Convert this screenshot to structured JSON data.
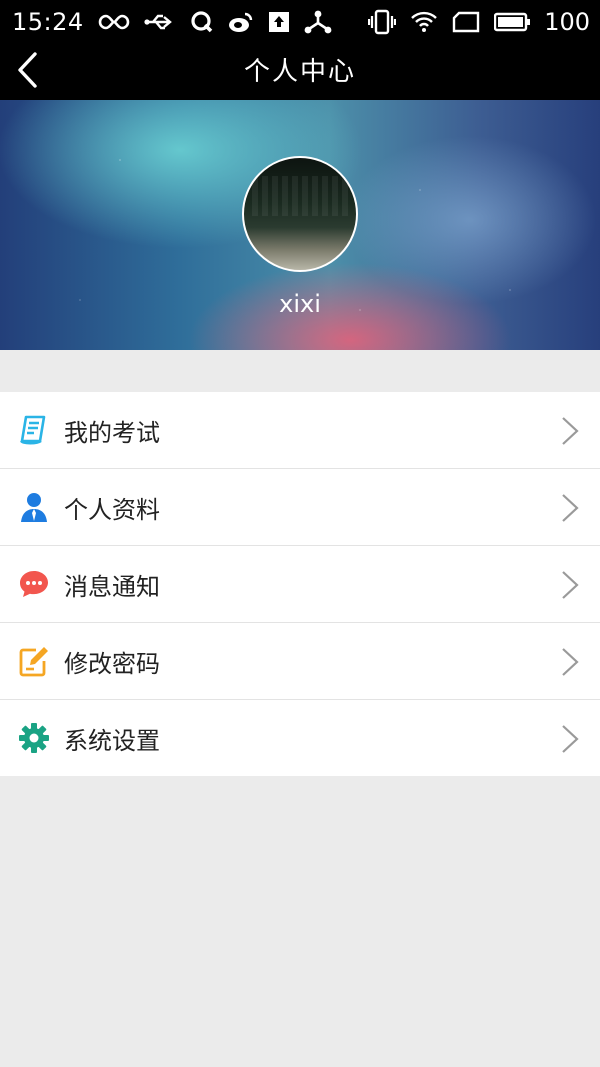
{
  "status_bar": {
    "time": "15:24",
    "battery_level": "100",
    "left_icons": [
      "infinity-icon",
      "usb-icon",
      "q-app-icon",
      "weibo-icon",
      "upload-icon",
      "share-icon"
    ],
    "right_icons": [
      "vibrate-icon",
      "wifi-icon",
      "sim-icon",
      "battery-icon"
    ]
  },
  "header": {
    "title": "个人中心",
    "back_icon": "back-chevron-icon"
  },
  "profile": {
    "username": "xixi"
  },
  "menu": {
    "items": [
      {
        "label": "我的考试",
        "icon": "exam-icon",
        "color": "#2ab4e6"
      },
      {
        "label": "个人资料",
        "icon": "profile-icon",
        "color": "#1e7ce0"
      },
      {
        "label": "消息通知",
        "icon": "message-icon",
        "color": "#f2564e"
      },
      {
        "label": "修改密码",
        "icon": "edit-password-icon",
        "color": "#f5a623"
      },
      {
        "label": "系统设置",
        "icon": "settings-gear-icon",
        "color": "#1aa384"
      }
    ]
  },
  "colors": {
    "topbar": "#000000",
    "background": "#ebebeb",
    "menu_background": "#ffffff",
    "divider": "#e3e3e3"
  }
}
